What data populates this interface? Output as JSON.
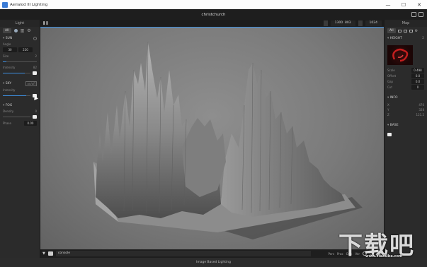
{
  "window": {
    "title": "Aerialod III Lighting",
    "minimize": "—",
    "maximize": "☐",
    "close": "✕"
  },
  "document": {
    "name": "christchurch"
  },
  "left_panel": {
    "title": "Light",
    "tab_all": "All",
    "sun": {
      "label": "SUN",
      "angle_label": "Angle",
      "angle_values": [
        "30",
        "220"
      ],
      "size_label": "Size",
      "size_value": "2",
      "size_level": 0.1,
      "intensity_label": "Intensity",
      "intensity_value": "82",
      "intensity_level": 0.8
    },
    "sky": {
      "label": "SKY",
      "toggle_label": "on/off",
      "intensity_label": "Intensity",
      "intensity_value": "0",
      "intensity_level": 0.85
    },
    "fog": {
      "label": "FOG",
      "density_label": "Density",
      "density_value": "0",
      "density_level": 0.0,
      "phase_label": "Phase",
      "phase_value": "0.00"
    }
  },
  "viewport": {
    "pause_icon": "❚❚",
    "width": "1300",
    "height": "803",
    "samples": "1024"
  },
  "console": {
    "toggle": "▼",
    "text": "console",
    "modes": [
      "Pers",
      "Prox",
      "Orth",
      "Ver"
    ]
  },
  "right_panel": {
    "title": "Map",
    "tab_all": "All",
    "height": {
      "label": "HEIGHT",
      "channel_count": "2",
      "rows": [
        {
          "label": "Scale",
          "value": "0.498"
        },
        {
          "label": "Offset",
          "value": "0.0"
        },
        {
          "label": "Gap",
          "value": "0.0"
        },
        {
          "label": "Cut",
          "value": "0"
        }
      ]
    },
    "info": {
      "label": "INFO",
      "rows": [
        {
          "label": "X",
          "value": "476"
        },
        {
          "label": "Y",
          "value": "328"
        },
        {
          "label": "Z",
          "value": "121.2"
        }
      ]
    },
    "base": {
      "label": "BASE"
    }
  },
  "status": {
    "text": "Image Based Lighting"
  },
  "watermark": {
    "text": "下载吧",
    "url": "www.xiazaiba.com"
  },
  "colors": {
    "accent": "#3d8fe0",
    "terrain": "#8a8a8a",
    "height_map": "#c41e1e"
  }
}
